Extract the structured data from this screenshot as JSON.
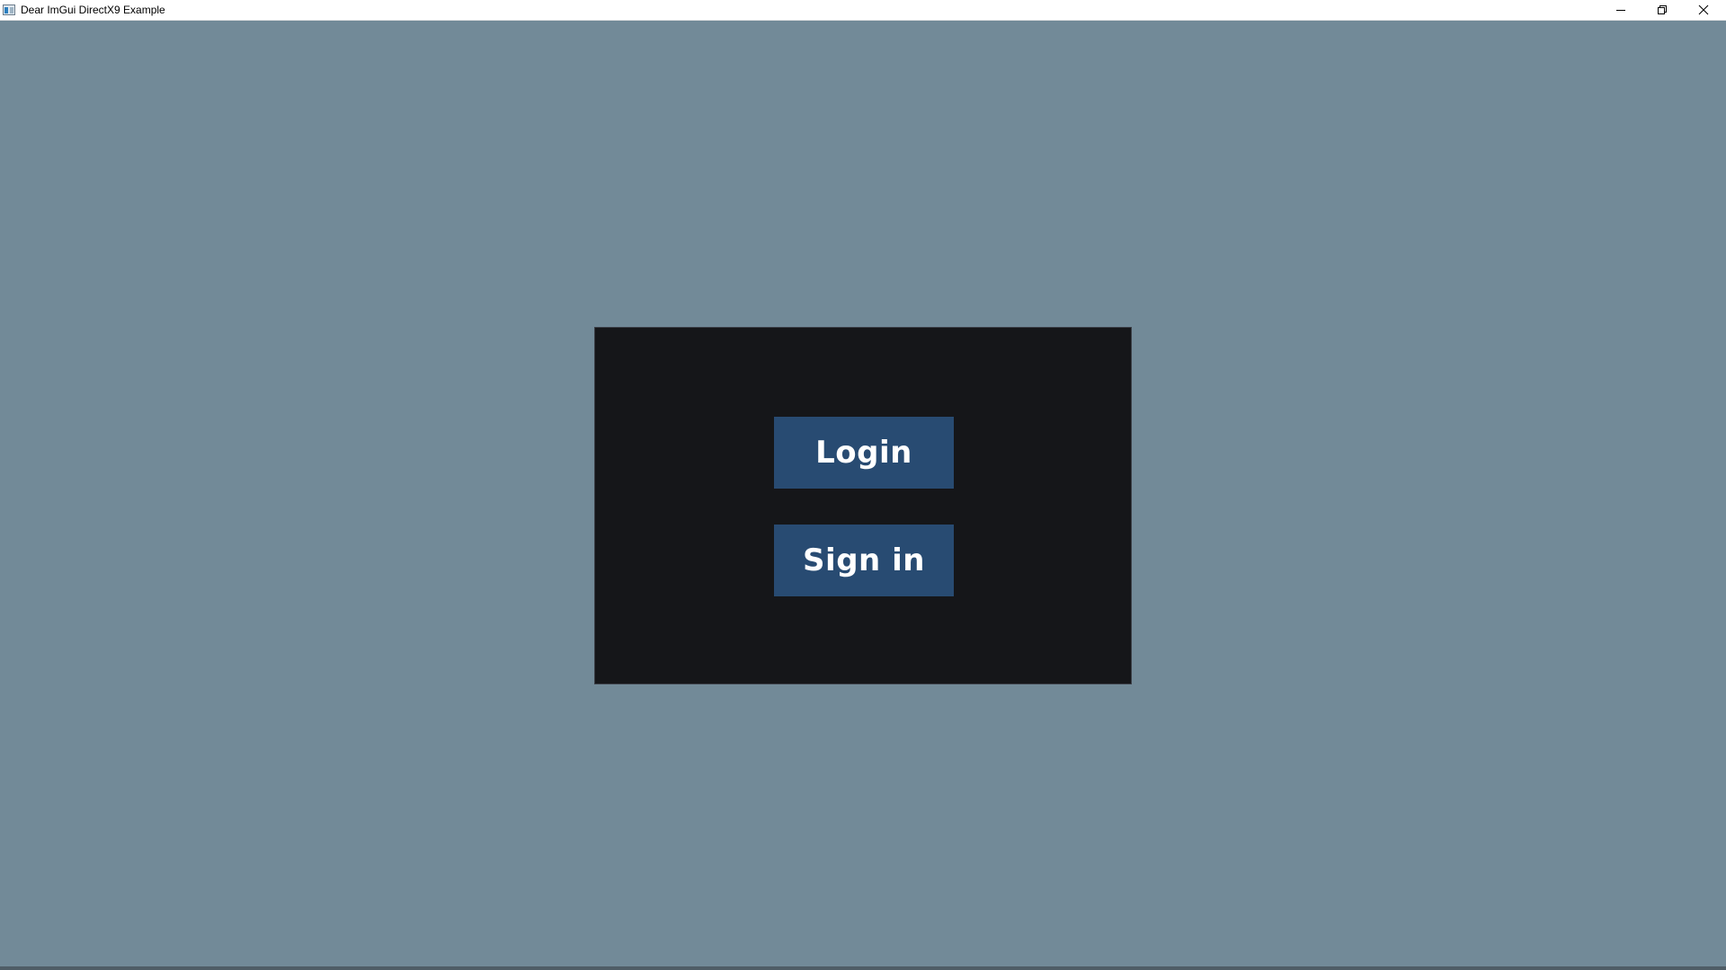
{
  "window": {
    "title": "Dear ImGui DirectX9 Example",
    "background_color": "#728a98",
    "caption_buttons": [
      "minimize-icon",
      "restore-icon",
      "close-icon"
    ]
  },
  "panel": {
    "background_color": "#151619",
    "buttons": [
      {
        "label": "Login",
        "color": "#284b72"
      },
      {
        "label": "Sign in",
        "color": "#284b72"
      }
    ]
  }
}
